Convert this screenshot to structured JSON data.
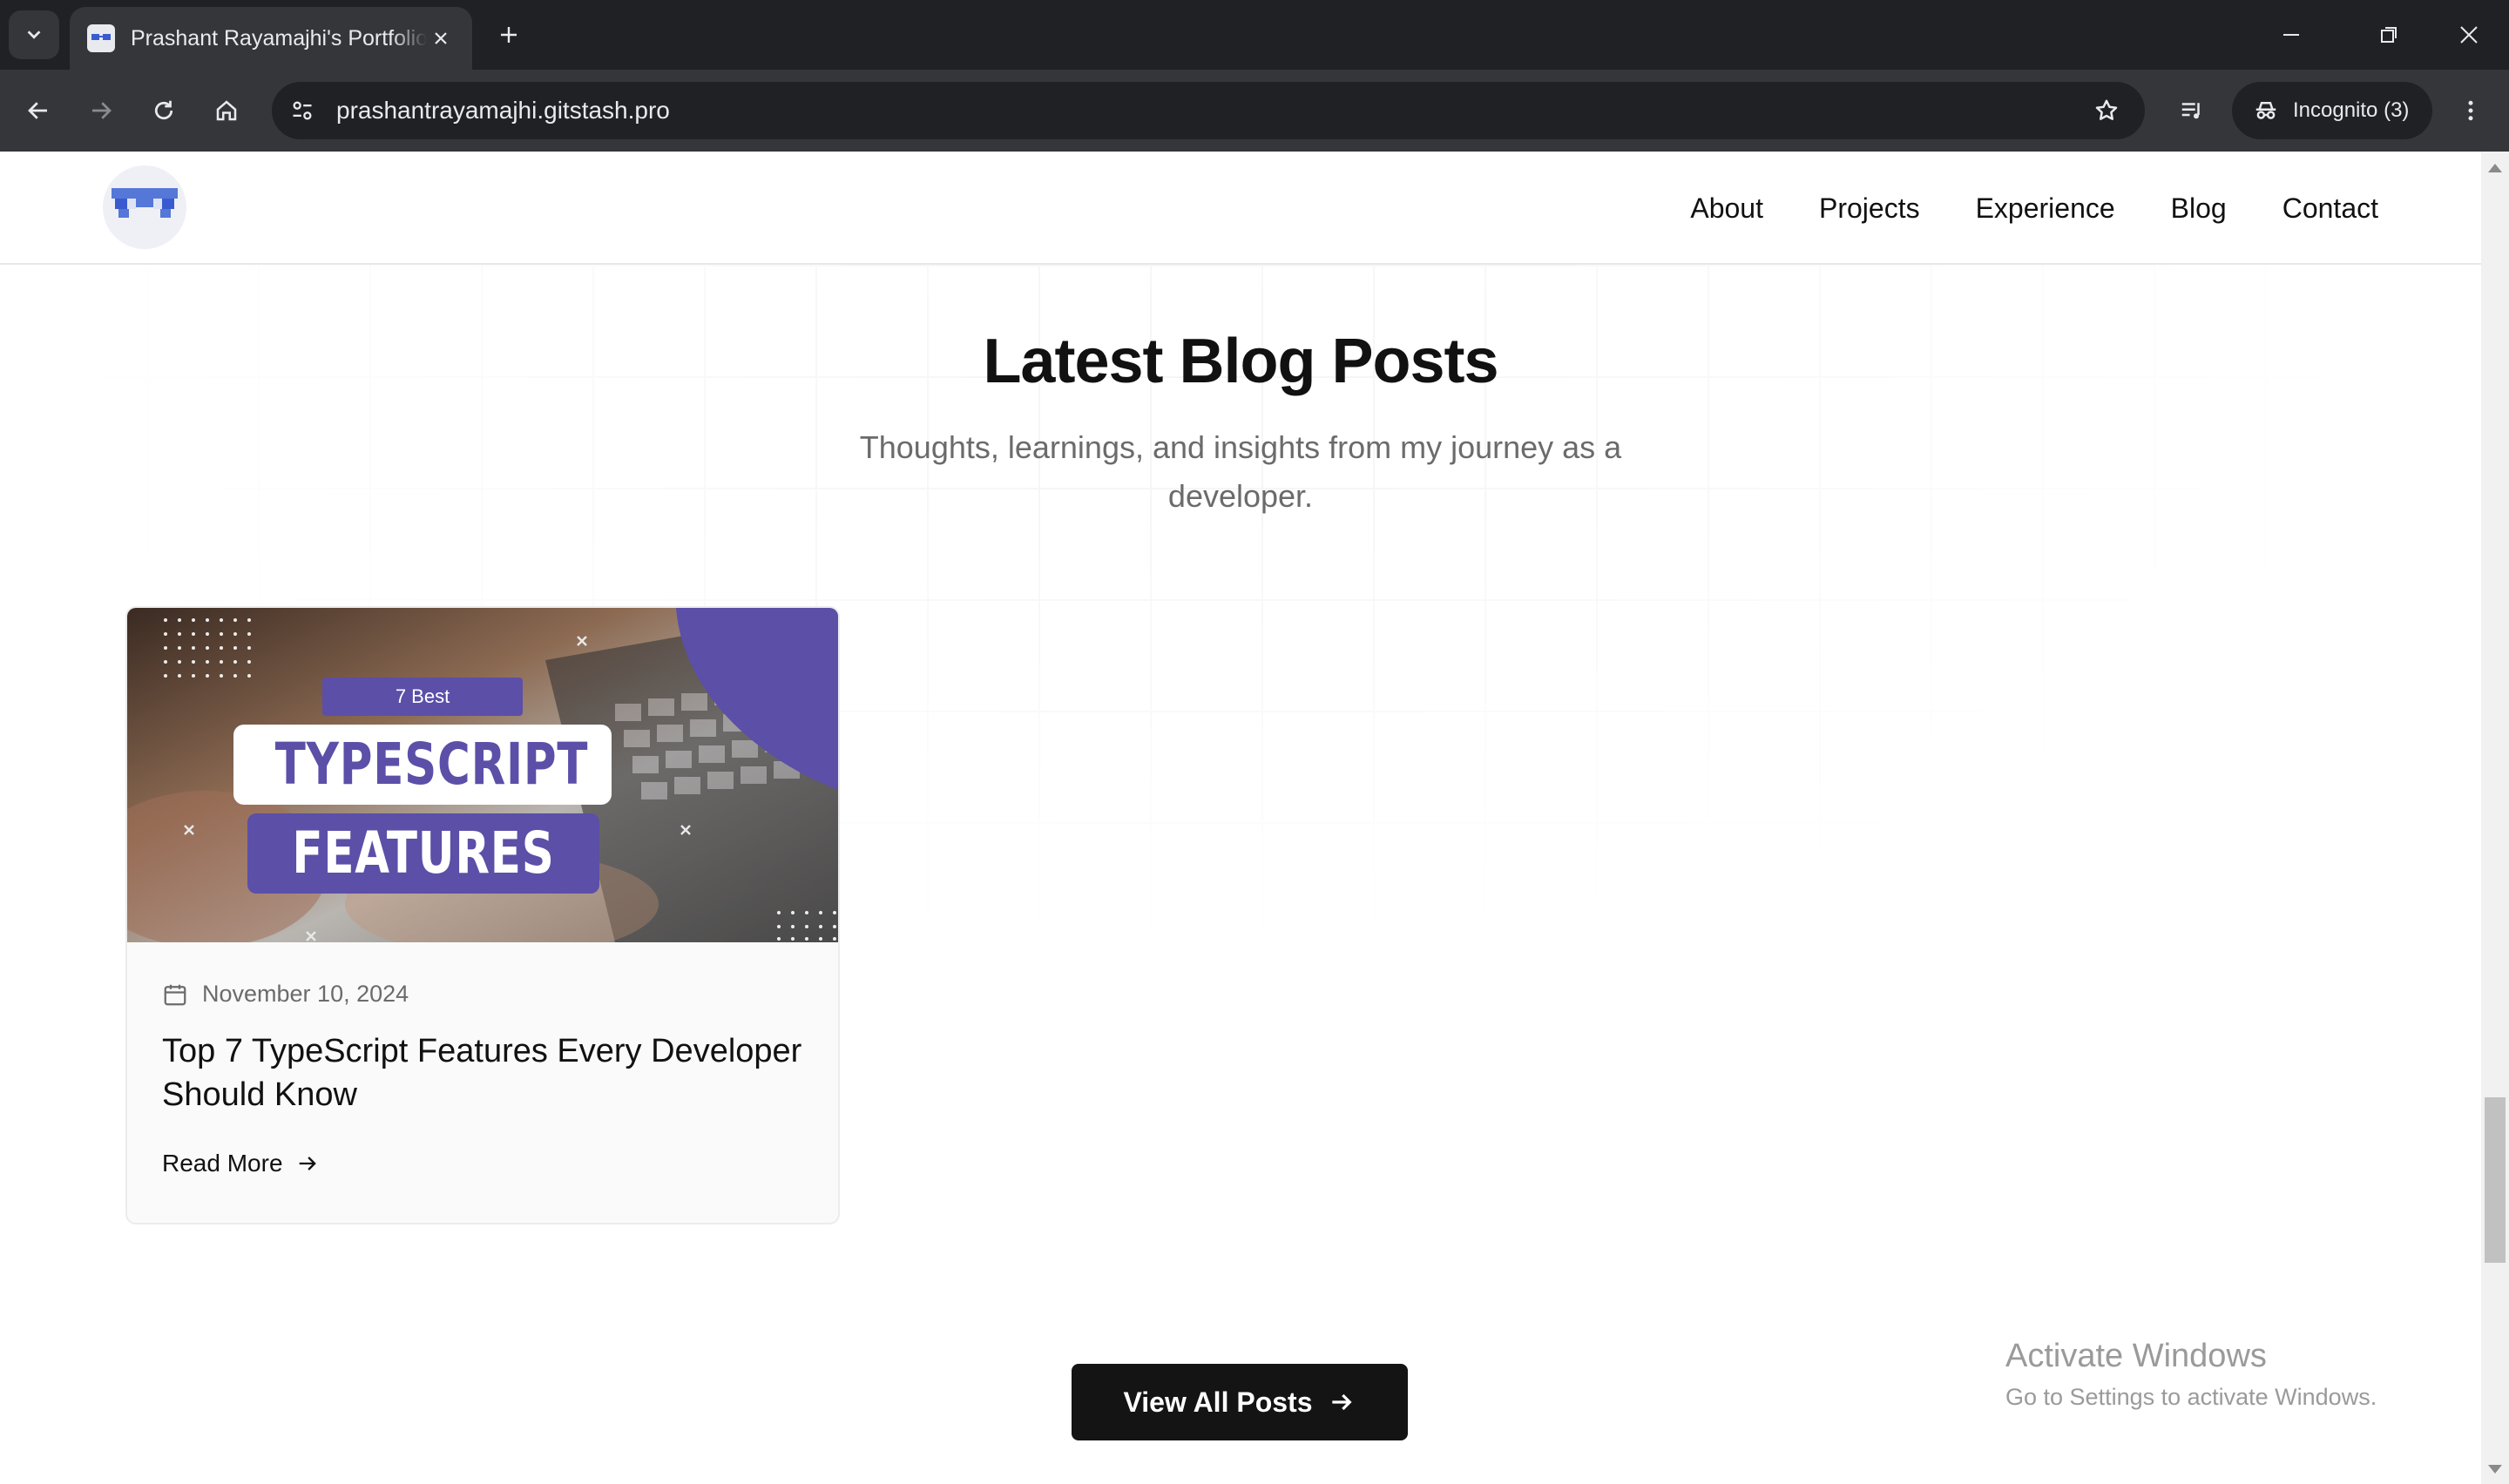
{
  "browser": {
    "tab_title": "Prashant Rayamajhi's Portfolio |",
    "url": "prashantrayamajhi.gitstash.pro",
    "incognito_label": "Incognito (3)"
  },
  "site": {
    "nav": [
      "About",
      "Projects",
      "Experience",
      "Blog",
      "Contact"
    ]
  },
  "blog": {
    "title": "Latest Blog Posts",
    "subtitle": "Thoughts, learnings, and insights from my journey as a developer.",
    "posts": [
      {
        "image_badge": "7 Best",
        "image_line1": "TYPESCRIPT",
        "image_line2": "FEATURES",
        "date": "November 10, 2024",
        "title": "Top 7 TypeScript Features Every Developer Should Know",
        "link_label": "Read More"
      }
    ],
    "view_all_label": "View All Posts"
  },
  "os_watermark": {
    "line1": "Activate Windows",
    "line2": "Go to Settings to activate Windows."
  },
  "colors": {
    "accent_purple": "#5b4fa8",
    "button_dark": "#141414"
  }
}
